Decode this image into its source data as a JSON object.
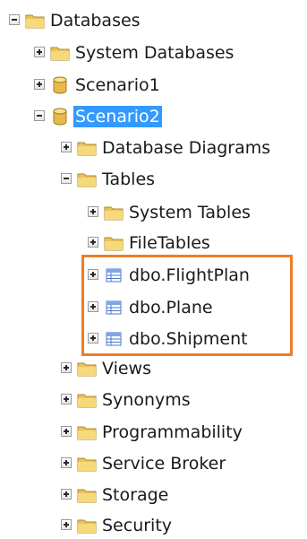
{
  "tree": {
    "databases": "Databases",
    "system_databases": "System Databases",
    "scenario1": "Scenario1",
    "scenario2": "Scenario2",
    "database_diagrams": "Database Diagrams",
    "tables": "Tables",
    "system_tables": "System Tables",
    "file_tables": "FileTables",
    "flight_plan": "dbo.FlightPlan",
    "plane": "dbo.Plane",
    "shipment": "dbo.Shipment",
    "views": "Views",
    "synonyms": "Synonyms",
    "programmability": "Programmability",
    "service_broker": "Service Broker",
    "storage": "Storage",
    "security": "Security"
  },
  "colors": {
    "folder": "#e9c45a",
    "selection": "#3399ff",
    "highlight_border": "#f07c25"
  }
}
